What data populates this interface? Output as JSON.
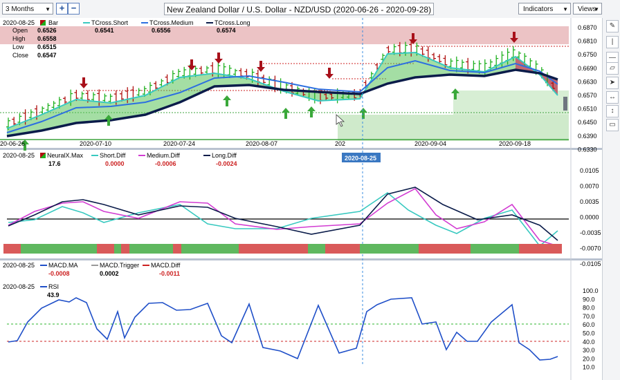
{
  "toolbar": {
    "timeframe": "3 Months",
    "zoom_in": "+",
    "zoom_out": "−",
    "title": "New Zealand Dollar / U.S. Dollar - NZD/USD (2020-06-26 - 2020-09-28)",
    "indicators": "Indicators",
    "views": "Views"
  },
  "price_panel": {
    "date": "2020-08-25",
    "bar_label": "Bar",
    "open_label": "Open",
    "open": "0.6526",
    "high_label": "High",
    "high": "0.6558",
    "low_label": "Low",
    "low": "0.6515",
    "close_label": "Close",
    "close": "0.6547",
    "short_label": "TCross.Short",
    "short": "0.6541",
    "medium_label": "TCross.Medium",
    "medium": "0.6556",
    "long_label": "TCross.Long",
    "long": "0.6574",
    "y_ticks": [
      "0.6870",
      "0.6810",
      "0.6750",
      "0.6690",
      "0.6630",
      "0.6570",
      "0.6510",
      "0.6450",
      "0.6390",
      "0.6330"
    ],
    "x_ticks": [
      "20-06-26",
      "2020-07-10",
      "2020-07-24",
      "2020-08-07",
      "2020-08-25",
      "2020-09-04",
      "2020-09-18"
    ],
    "cursor_date": "2020-08-25",
    "x_cut": "202"
  },
  "neural_panel": {
    "date": "2020-08-25",
    "neural_label": "NeuralX.Max",
    "neural": "17.6",
    "short_label": "Short.Diff",
    "short": "0.0000",
    "medium_label": "Medium.Diff",
    "medium": "-0.0006",
    "long_label": "Long.Diff",
    "long": "-0.0024",
    "y_ticks": [
      "0.0105",
      "0.0070",
      "0.0035",
      "0.0000",
      "-0.0035",
      "-0.0070",
      "-0.0105"
    ]
  },
  "macd_panel": {
    "date": "2020-08-25",
    "ma_label": "MACD.MA",
    "ma": "-0.0008",
    "trigger_label": "MACD.Trigger",
    "trigger": "0.0002",
    "diff_label": "MACD.Diff",
    "diff": "-0.0011"
  },
  "rsi_panel": {
    "date": "2020-08-25",
    "rsi_label": "RSI",
    "rsi": "43.9",
    "y_ticks": [
      "100.0",
      "90.0",
      "80.0",
      "70.0",
      "60.0",
      "50.0",
      "40.0",
      "30.0",
      "20.0",
      "10.0"
    ]
  },
  "colors": {
    "short": "#38c9c0",
    "medium": "#2d6fe0",
    "long": "#0b1c4a",
    "bull": "#1eb01e",
    "bear": "#b01010",
    "magenta": "#d23bd2",
    "rsi": "#1f4fc8",
    "band_green": "#29a329",
    "band_red": "#cc2222"
  },
  "right_tools": [
    "pencil-icon",
    "vertical-line-icon",
    "horizontal-line-icon",
    "eraser-icon",
    "cursor-icon",
    "move-left-right-icon",
    "move-up-down-icon",
    "comment-icon"
  ]
}
